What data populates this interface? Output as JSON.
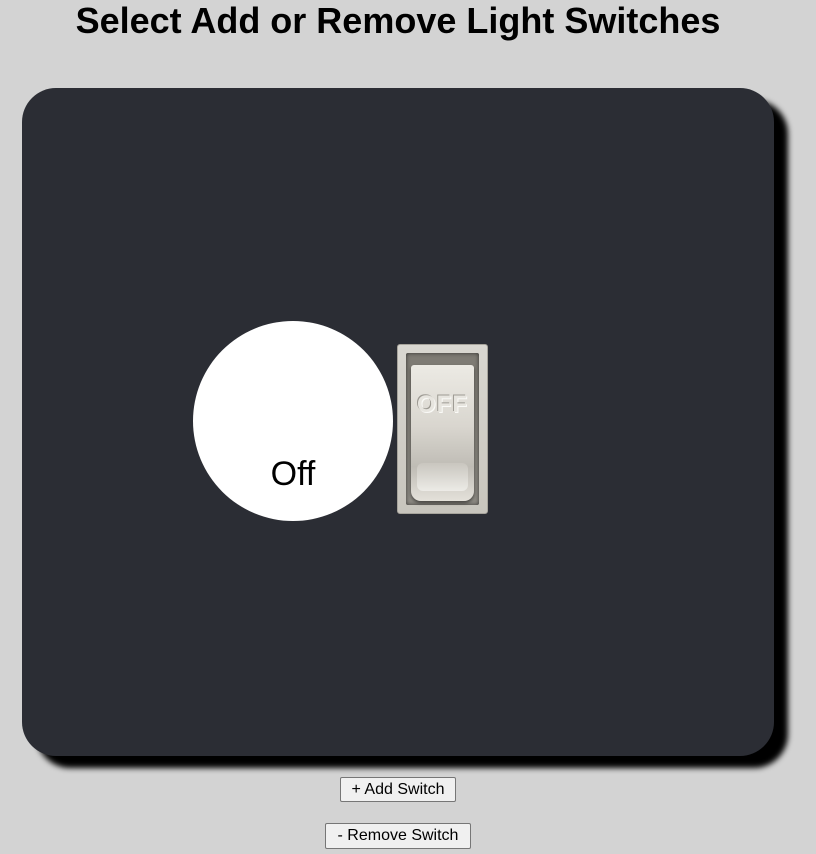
{
  "header": {
    "title": "Select Add or Remove Light Switches"
  },
  "panel": {
    "switches": [
      {
        "bulb_state_label": "Off",
        "toggle_text": "OFF"
      }
    ]
  },
  "controls": {
    "add_label": "+ Add Switch",
    "remove_label": "- Remove Switch"
  },
  "colors": {
    "background": "#d3d3d3",
    "panel": "#2b2d34",
    "bulb_off": "#ffffff"
  }
}
